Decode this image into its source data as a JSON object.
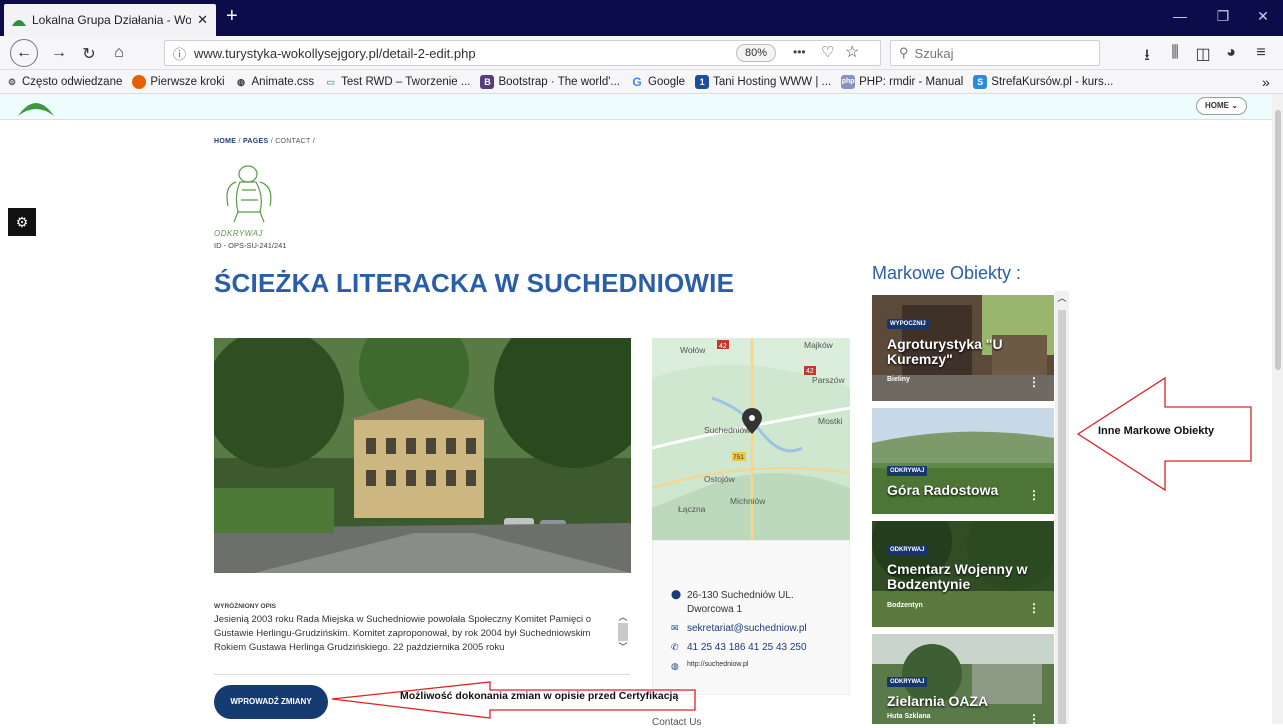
{
  "browser": {
    "tab_title": "Lokalna Grupa Działania - Wok",
    "tab_close": "✕",
    "new_tab": "+",
    "url": "www.turystyka-wokollysejgory.pl/detail-2-edit.php",
    "zoom": "80%",
    "search_placeholder": "Szukaj",
    "more": "•••",
    "bookmarks": [
      {
        "label": "Często odwiedzane",
        "icon": "gear-icon"
      },
      {
        "label": "Pierwsze kroki",
        "icon": "firefox-icon"
      },
      {
        "label": "Animate.css",
        "icon": "globe-icon"
      },
      {
        "label": "Test RWD – Tworzenie ...",
        "icon": "page-icon"
      },
      {
        "label": "Bootstrap · The world'...",
        "icon": "bootstrap-icon"
      },
      {
        "label": "Google",
        "icon": "google-icon"
      },
      {
        "label": "Tani Hosting WWW | ...",
        "icon": "hosting-icon"
      },
      {
        "label": "PHP: rmdir - Manual",
        "icon": "php-icon"
      },
      {
        "label": "StrefaKursów.pl - kurs...",
        "icon": "strefa-icon"
      }
    ],
    "overflow": "»"
  },
  "header": {
    "home_label": "HOME ⌄"
  },
  "breadcrumb": {
    "home": "HOME",
    "pages": "PAGES",
    "contact": "CONTACT"
  },
  "logo_text": "ODKRYWAJ",
  "identifier": "ID - OPS-SU-241/241",
  "page_title": "ŚCIEŻKA LITERACKA W SUCHEDNIOWIE",
  "map": {
    "labels": [
      "Wołów",
      "Majków",
      "Parszów",
      "Mostki",
      "Suchedniów",
      "Ostojów",
      "Michniów",
      "Łączna"
    ],
    "road_labels": [
      "42",
      "42",
      "751"
    ]
  },
  "contact": {
    "address_line1": "26-130 Suchedniów UL.",
    "address_line2": "Dworcowa 1",
    "email": "sekretariat@suchedniow.pl",
    "phone": "41 25 43 186 41 25 43 250",
    "website": "http://suchedniow.pl"
  },
  "description": {
    "label": "WYRÓŻNIONY OPIS",
    "text": "Jesienią 2003 roku Rada Miejska w Suchedniowie powołała Społeczny Komitet Pamięci o Gustawie Herlingu-Grudzińskim. Komitet zaproponował, by rok 2004 był Suchedniowskim Rokiem Gustawa Herlinga Grudzińskiego. 22 października 2005 roku"
  },
  "edit_button": "WPROWADŹ ZMIANY",
  "annotation_edit": "Możliwość dokonania zmian w opisie przed Certyfikacją",
  "annotation_objects": "Inne Markowe Obiekty",
  "sidebar": {
    "title": "Markowe Obiekty :",
    "cards": [
      {
        "tag": "WYPOCZNIJ",
        "title": "Agroturystyka \"U Kuremzy\"",
        "subtitle": "Bieliny"
      },
      {
        "tag": "ODKRYWAJ",
        "title": "Góra Radostowa",
        "subtitle": ""
      },
      {
        "tag": "ODKRYWAJ",
        "title": "Cmentarz Wojenny w Bodzentynie",
        "subtitle": "Bodzentyn"
      },
      {
        "tag": "ODKRYWAJ",
        "title": "Zielarnia OAZA",
        "subtitle": "Huta Szklana"
      }
    ]
  },
  "contact_us_partial": "Contact Us",
  "colors": {
    "title_blue": "#2a5ea8",
    "button_navy": "#163a72",
    "arrow_red": "#e02020",
    "titlebar": "#0c0c4a"
  }
}
